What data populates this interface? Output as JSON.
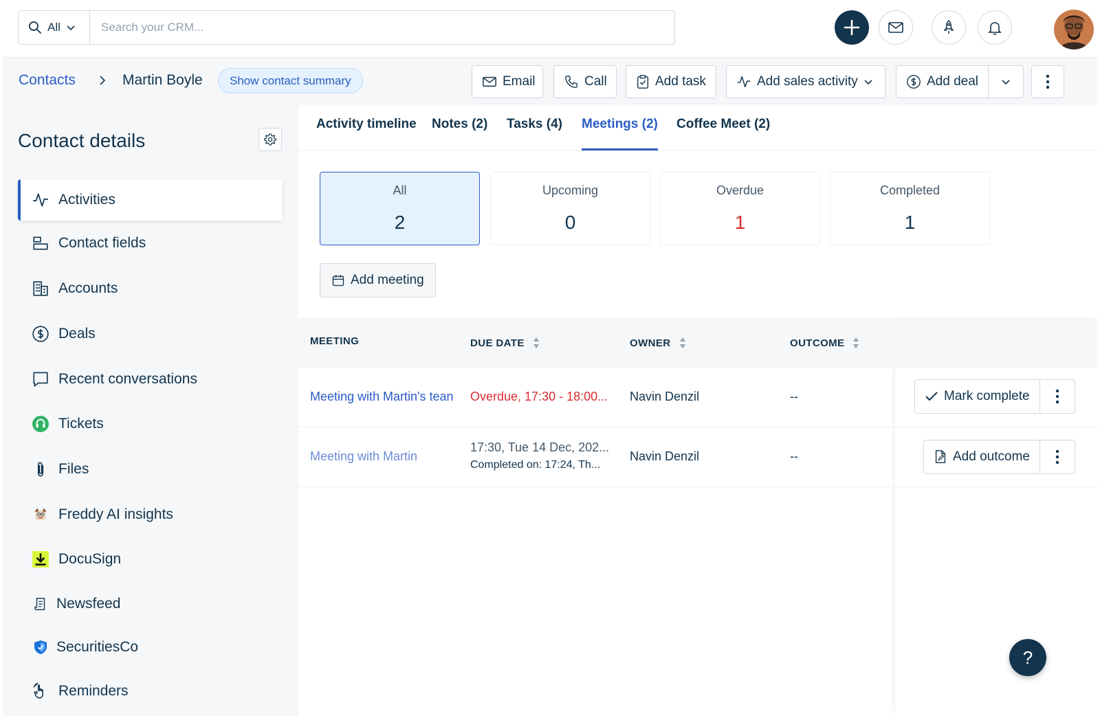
{
  "search": {
    "scope_label": "All",
    "placeholder": "Search your CRM..."
  },
  "breadcrumb": {
    "parent": "Contacts",
    "current": "Martin Boyle",
    "summary_pill": "Show contact summary"
  },
  "header_actions": {
    "email": "Email",
    "call": "Call",
    "add_task": "Add task",
    "add_sales_activity": "Add sales activity",
    "add_deal": "Add deal"
  },
  "sidebar": {
    "title": "Contact details",
    "items": [
      {
        "label": "Activities",
        "icon": "activity-icon"
      },
      {
        "label": "Contact fields",
        "icon": "fields-icon"
      },
      {
        "label": "Accounts",
        "icon": "building-icon"
      },
      {
        "label": "Deals",
        "icon": "dollar-icon"
      },
      {
        "label": "Recent conversations",
        "icon": "chat-icon"
      },
      {
        "label": "Tickets",
        "icon": "headset-icon"
      },
      {
        "label": "Files",
        "icon": "paperclip-icon"
      },
      {
        "label": "Freddy AI insights",
        "icon": "freddy-icon"
      },
      {
        "label": "DocuSign",
        "icon": "docusign-icon"
      },
      {
        "label": "Newsfeed",
        "icon": "newsfeed-icon"
      },
      {
        "label": "SecuritiesCo",
        "icon": "shield-icon"
      },
      {
        "label": "Reminders",
        "icon": "hand-icon"
      }
    ]
  },
  "tabs": [
    {
      "label": "Activity timeline"
    },
    {
      "label": "Notes (2)"
    },
    {
      "label": "Tasks (4)"
    },
    {
      "label": "Meetings (2)"
    },
    {
      "label": "Coffee Meet (2)"
    }
  ],
  "stats": [
    {
      "label": "All",
      "value": "2"
    },
    {
      "label": "Upcoming",
      "value": "0"
    },
    {
      "label": "Overdue",
      "value": "1"
    },
    {
      "label": "Completed",
      "value": "1"
    }
  ],
  "add_meeting_label": "Add meeting",
  "table": {
    "columns": [
      "MEETING",
      "DUE DATE",
      "OWNER",
      "OUTCOME"
    ],
    "rows": [
      {
        "meeting": "Meeting with Martin's tean",
        "due": "Overdue, 17:30 - 18:00...",
        "owner": "Navin Denzil",
        "outcome": "--",
        "action": "Mark complete"
      },
      {
        "meeting": "Meeting with Martin",
        "due": "17:30, Tue 14 Dec, 202...",
        "due_sub": "Completed on: 17:24, Th...",
        "owner": "Navin Denzil",
        "outcome": "--",
        "action": "Add outcome"
      }
    ]
  },
  "help_label": "?",
  "colors": {
    "accent": "#2c5cc5",
    "navy": "#12344d",
    "overdue": "#d72d30",
    "active_bg": "#e5f2fd"
  }
}
